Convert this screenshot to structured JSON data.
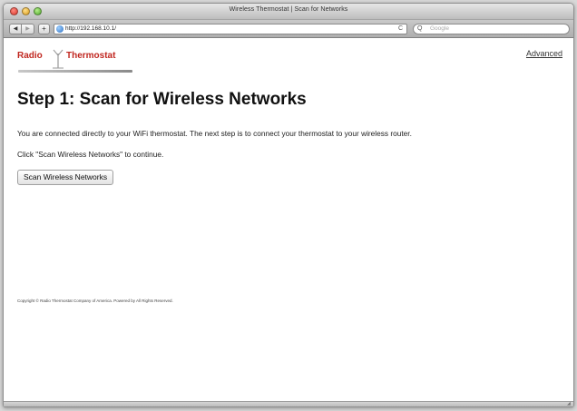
{
  "window": {
    "title": "Wireless Thermostat | Scan for Networks"
  },
  "toolbar": {
    "back_glyph": "◀",
    "forward_glyph": "▶",
    "add_glyph": "+",
    "url": "http://192.168.10.1/",
    "reload_glyph": "C",
    "search_glyph": "Q",
    "search_placeholder": "Google"
  },
  "logo": {
    "word1": "Radio",
    "word2": "Thermostat"
  },
  "header": {
    "advanced_link": "Advanced"
  },
  "main": {
    "heading": "Step 1: Scan for Wireless Networks",
    "paragraph1": "You are connected directly to your WiFi thermostat. The next step is to connect your thermostat to your wireless router.",
    "paragraph2": "Click \"Scan Wireless Networks\" to continue.",
    "scan_button": "Scan Wireless Networks"
  },
  "footer": {
    "text": "Copyright © Radio Thermostat Company of America. Powered by All Rights Reserved."
  },
  "colors": {
    "logo_red": "#c0261f"
  }
}
